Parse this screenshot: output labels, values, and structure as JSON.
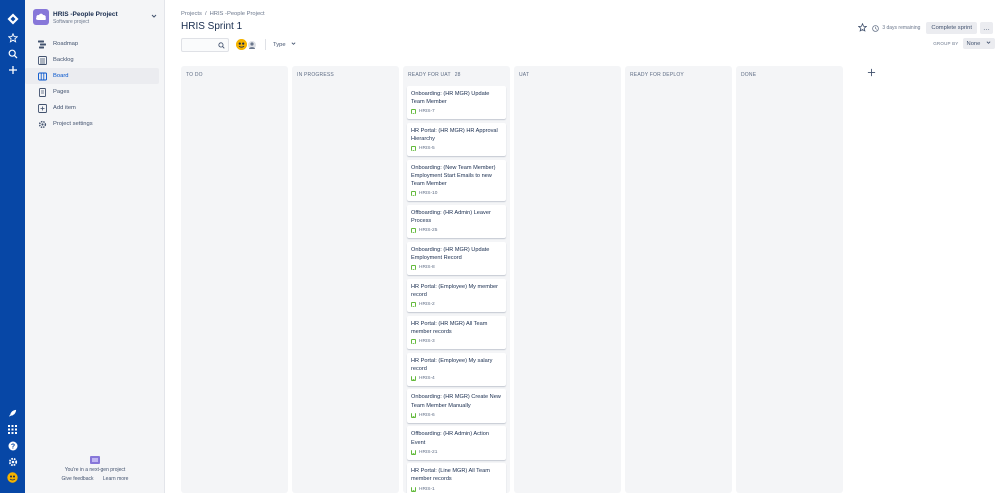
{
  "colors": {
    "global_nav": "#0747a6",
    "sidebar_bg": "#f4f5f7",
    "column_bg": "#f4f5f7",
    "active_nav": "#0052cc",
    "story_icon": "#63ba3c",
    "project_avatar": "#8777d9"
  },
  "global_nav": {
    "icons": [
      "jira-logo-icon",
      "star-icon",
      "search-icon",
      "plus-icon",
      "rocket-icon",
      "app-switcher-icon",
      "help-icon",
      "settings-icon",
      "user-avatar-icon"
    ]
  },
  "project": {
    "name": "HRIS -People Project",
    "type": "Software project"
  },
  "sidebar": {
    "items": [
      {
        "label": "Roadmap",
        "icon": "roadmap-icon"
      },
      {
        "label": "Backlog",
        "icon": "backlog-icon"
      },
      {
        "label": "Board",
        "icon": "board-icon",
        "active": true
      },
      {
        "label": "Pages",
        "icon": "pages-icon"
      },
      {
        "label": "Add item",
        "icon": "add-item-icon"
      },
      {
        "label": "Project settings",
        "icon": "settings-icon"
      }
    ],
    "nextgen_text": "You're in a next-gen project",
    "give_feedback": "Give feedback",
    "learn_more": "Learn more"
  },
  "breadcrumb": {
    "projects": "Projects",
    "separator": "/",
    "project": "HRIS -People Project"
  },
  "page_title": "HRIS Sprint 1",
  "header_actions": {
    "remaining": "3 days remaining",
    "complete_sprint": "Complete sprint",
    "more": "…"
  },
  "toolbar": {
    "type_filter": "Type",
    "group_by_label": "GROUP BY",
    "group_by_value": "None"
  },
  "columns": [
    {
      "title": "TO DO",
      "count": ""
    },
    {
      "title": "IN PROGRESS",
      "count": ""
    },
    {
      "title": "READY FOR UAT",
      "count": "28"
    },
    {
      "title": "UAT",
      "count": ""
    },
    {
      "title": "READY FOR DEPLOY",
      "count": ""
    },
    {
      "title": "DONE",
      "count": ""
    }
  ],
  "cards": [
    {
      "summary": "Onboarding: (HR MGR) Update Team Member",
      "key": "HRIS-7"
    },
    {
      "summary": "HR Portal: (HR MGR) HR Approval Hierarchy",
      "key": "HRIS-5"
    },
    {
      "summary": "Onboarding: (New Team Member) Employment Start Emails to new Team Member",
      "key": "HRIS-10"
    },
    {
      "summary": "Offboarding: (HR Admin) Leaver Process",
      "key": "HRIS-25"
    },
    {
      "summary": "Onboarding: (HR MGR) Update Employment Record",
      "key": "HRIS-8"
    },
    {
      "summary": "HR Portal: (Employee) My member record",
      "key": "HRIS-2"
    },
    {
      "summary": "HR Portal: (HR MGR) All Team member records",
      "key": "HRIS-3"
    },
    {
      "summary": "HR Portal: (Employee) My salary record",
      "key": "HRIS-4"
    },
    {
      "summary": "Onboarding: (HR MGR) Create New Team Member Manually",
      "key": "HRIS-6"
    },
    {
      "summary": "Offboarding: (HR Admin) Action Event",
      "key": "HRIS-21"
    },
    {
      "summary": "HR Portal: (Line MGR) All Team member records",
      "key": "HRIS-1"
    }
  ]
}
